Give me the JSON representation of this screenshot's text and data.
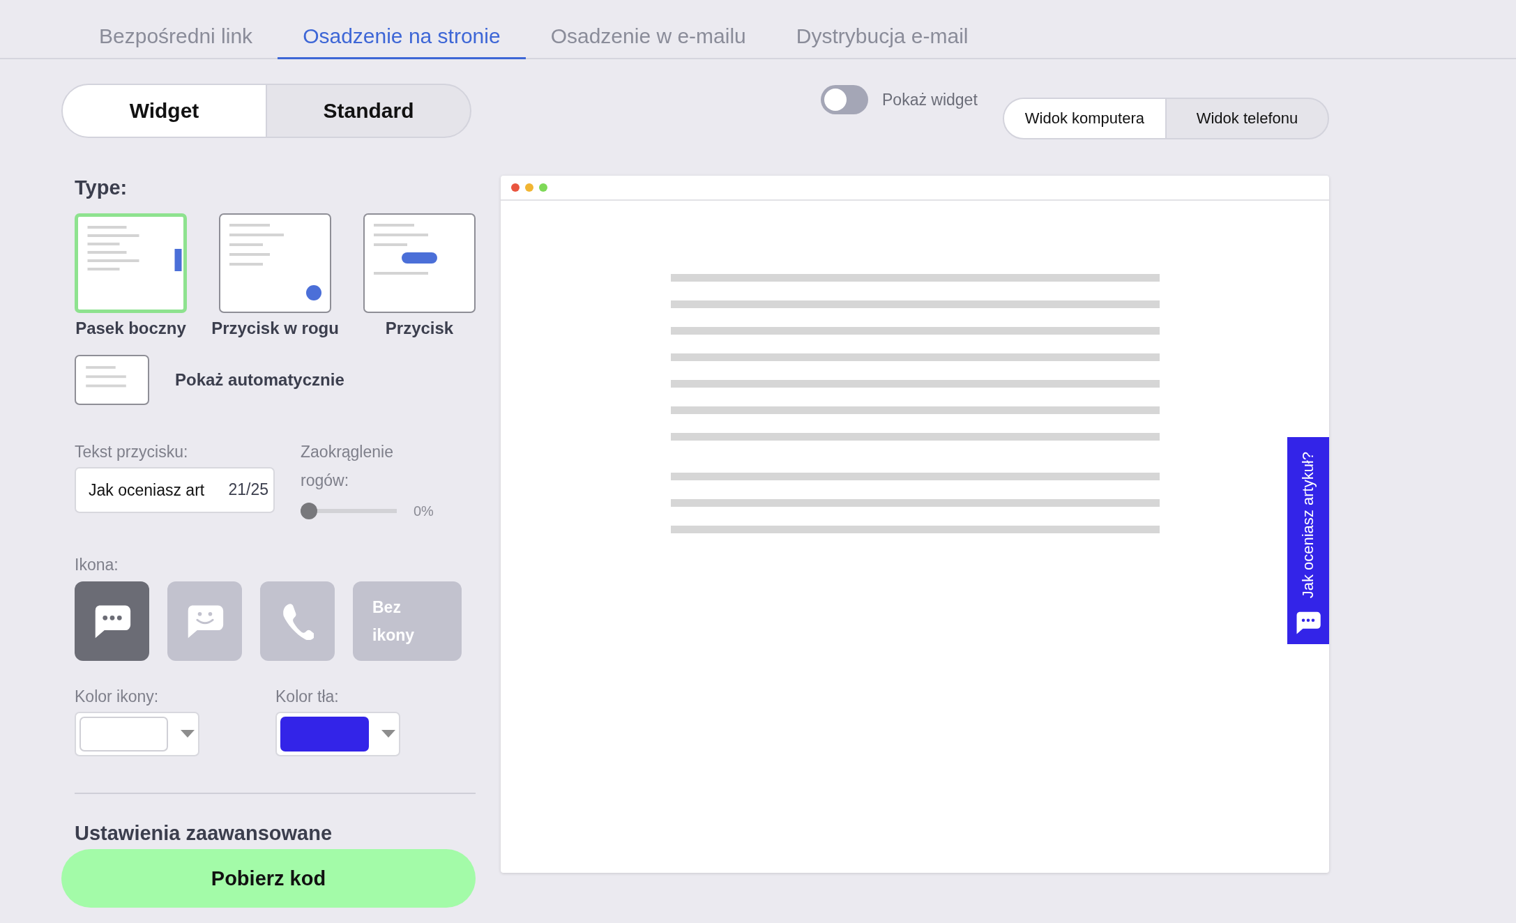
{
  "tabs": [
    {
      "label": "Bezpośredni link",
      "selected": false
    },
    {
      "label": "Osadzenie na stronie",
      "selected": true
    },
    {
      "label": "Osadzenie w e-mailu",
      "selected": false
    },
    {
      "label": "Dystrybucja e-mail",
      "selected": false
    }
  ],
  "mode_switch": [
    {
      "label": "Widget",
      "selected": true
    },
    {
      "label": "Standard",
      "selected": false
    }
  ],
  "show_widget": {
    "label": "Pokaż widget",
    "on": false
  },
  "view_switch": [
    {
      "label": "Widok komputera",
      "selected": true
    },
    {
      "label": "Widok telefonu",
      "selected": false
    }
  ],
  "type_section": {
    "title": "Type:",
    "options": [
      {
        "kind": "sidebar",
        "label": "Pasek boczny",
        "selected": true
      },
      {
        "kind": "corner",
        "label": "Przycisk w rogu",
        "selected": false
      },
      {
        "kind": "button",
        "label": "Przycisk",
        "selected": false
      }
    ],
    "auto_show": {
      "label": "Pokaż automatycznie",
      "selected": false
    }
  },
  "button_text": {
    "label": "Tekst przycisku:",
    "value": "Jak oceniasz art",
    "counter": "21/25"
  },
  "corner_rounding": {
    "label_line_1": "Zaokrąglenie",
    "label_line_2": "rogów:",
    "level": 0,
    "reading": "0%"
  },
  "icon_section": {
    "title": "Ikona:",
    "options": [
      {
        "kind": "chat",
        "selected": true
      },
      {
        "kind": "smile",
        "selected": false
      },
      {
        "kind": "phone",
        "selected": false
      },
      {
        "kind": "none",
        "label_line_1": "Bez",
        "label_line_2": "ikony",
        "selected": false
      }
    ]
  },
  "icon_color": {
    "label": "Kolor ikony:",
    "color": "#ffffff"
  },
  "background_color": {
    "label": "Kolor tła:",
    "color": "#3324e8"
  },
  "advanced_settings": {
    "title": "Ustawienia zaawansowane"
  },
  "get_code_button": {
    "label": "Pobierz kod"
  },
  "preview": {
    "widget_text": "Jak oceniasz artykuł?"
  }
}
